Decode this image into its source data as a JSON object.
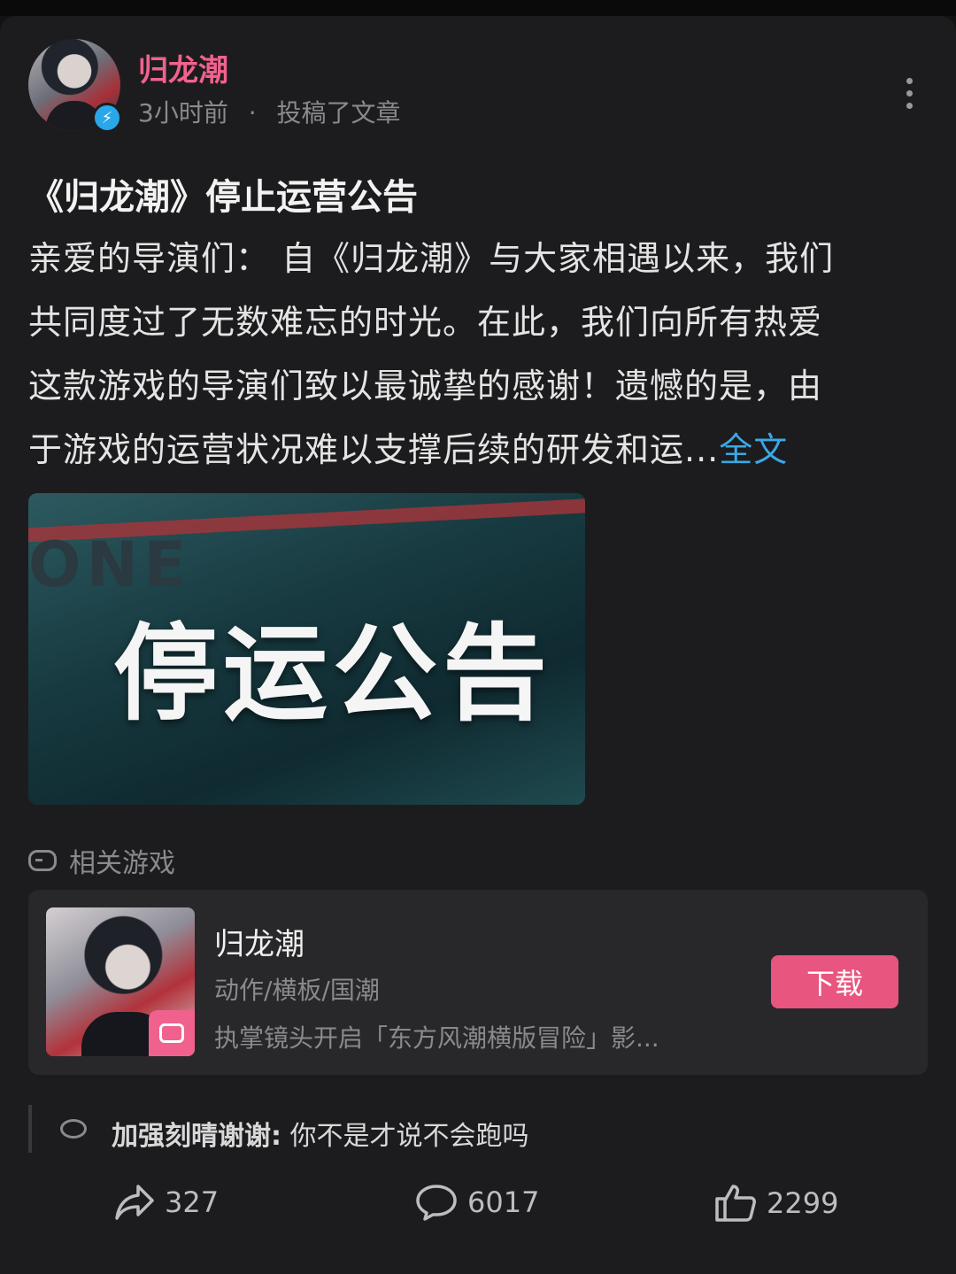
{
  "post": {
    "author": "归龙潮",
    "time": "3小时前",
    "separator": "·",
    "action": "投稿了文章",
    "title": "《归龙潮》停止运营公告",
    "body_lines": [
      "亲爱的导演们：  自《归龙潮》与大家相遇以来，我们",
      "共同度过了无数难忘的时光。在此，我们向所有热爱",
      "这款游戏的导演们致以最诚挚的感谢！遗憾的是，由",
      "于游戏的运营状况难以支撑后续的研发和运..."
    ],
    "full_text_link": "全文",
    "banner_text": "停运公告",
    "verified_icon": "lightning-icon",
    "more_icon": "more-vertical-icon"
  },
  "related": {
    "label": "相关游戏",
    "label_icon": "gamepad-icon",
    "game": {
      "name": "归龙潮",
      "tags": "动作/横板/国潮",
      "description": "执掌镜头开启「东方风潮横版冒险」影...",
      "download_label": "下载"
    }
  },
  "comment": {
    "user": "加强刻晴谢谢:",
    "text": " 你不是才说不会跑吗",
    "icon": "comment-bubble-icon"
  },
  "stats": {
    "shares": "327",
    "comments": "6017",
    "likes": "2299"
  },
  "colors": {
    "accent_pink": "#f0628d",
    "link_blue": "#3aa8e6",
    "download_button": "#e8557e",
    "verified_blue": "#2aa7e8"
  }
}
